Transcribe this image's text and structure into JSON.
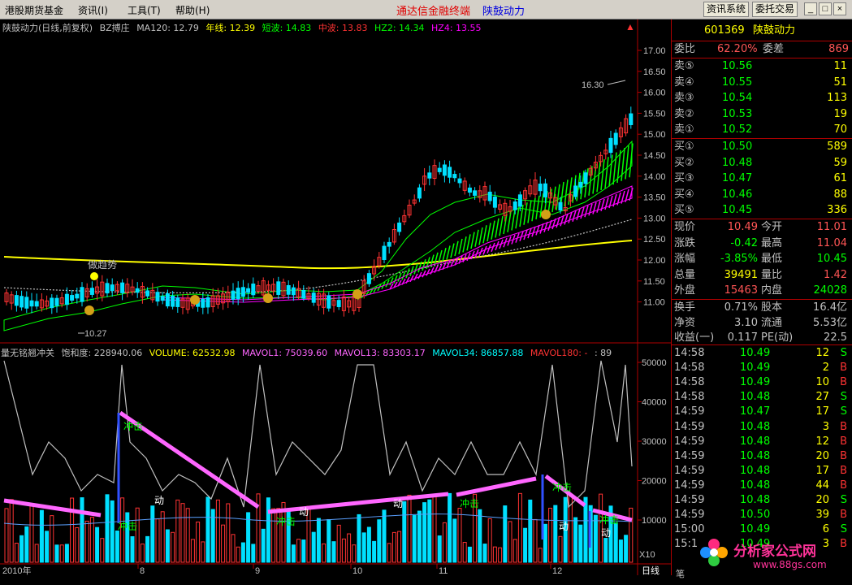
{
  "menu": {
    "items": [
      "港股期货基金",
      "资讯(I)",
      "工具(T)",
      "帮助(H)"
    ],
    "app_title": "通达信金融终端",
    "stock_title": "陕鼓动力",
    "right_buttons": [
      "资讯系统",
      "委托交易"
    ],
    "window_buttons": [
      "_",
      "□",
      "×"
    ]
  },
  "main_legend": {
    "name": "陕鼓动力(日线,前复权)",
    "indicator": "BZ搏庄",
    "ma120": "MA120: 12.79",
    "nianxian": "年线: 12.39",
    "duanbo": "短波: 14.83",
    "zhongbo": "中波: 13.83",
    "hz2": "HZ2: 14.34",
    "hz4": "HZ4: 13.55"
  },
  "price_axis": [
    "17.00",
    "16.50",
    "16.00",
    "15.50",
    "15.00",
    "14.50",
    "14.00",
    "13.50",
    "13.00",
    "12.50",
    "12.00",
    "11.50",
    "11.00"
  ],
  "annotations": {
    "high_label": "16.30",
    "low_label": "10.27",
    "trend_label": "做趋势"
  },
  "sub_legend": {
    "name": "量无铭翘冲关",
    "baohedu": "饱和度: 228940.06",
    "volume": "VOLUME: 62532.98",
    "mavol1": "MAVOL1: 75039.60",
    "mavol13": "MAVOL13: 83303.17",
    "mavol34": "MAVOL34: 86857.88",
    "mavol180": "MAVOL180: -",
    "tail": ": 89"
  },
  "vol_axis": [
    "50000",
    "40000",
    "30000",
    "20000",
    "10000"
  ],
  "vol_axis_unit": "X10",
  "vol_labels": [
    "冲击",
    "冲击",
    "冲击",
    "冲击",
    "冲击",
    "冲击",
    "动",
    "动",
    "动",
    "动",
    "动"
  ],
  "date_axis": [
    "2010年",
    "8",
    "9",
    "10",
    "11",
    "12"
  ],
  "date_axis_right": "日线",
  "quote": {
    "code": "601369",
    "name": "陕鼓动力",
    "weibi_label": "委比",
    "weibi": "62.20%",
    "weicha_label": "委差",
    "weicha": "869",
    "sells": [
      {
        "label": "卖⑤",
        "price": "10.56",
        "vol": "11"
      },
      {
        "label": "卖④",
        "price": "10.55",
        "vol": "51"
      },
      {
        "label": "卖③",
        "price": "10.54",
        "vol": "113"
      },
      {
        "label": "卖②",
        "price": "10.53",
        "vol": "19"
      },
      {
        "label": "卖①",
        "price": "10.52",
        "vol": "70"
      }
    ],
    "buys": [
      {
        "label": "买①",
        "price": "10.50",
        "vol": "589"
      },
      {
        "label": "买②",
        "price": "10.48",
        "vol": "59"
      },
      {
        "label": "买③",
        "price": "10.47",
        "vol": "61"
      },
      {
        "label": "买④",
        "price": "10.46",
        "vol": "88"
      },
      {
        "label": "买⑤",
        "price": "10.45",
        "vol": "336"
      }
    ],
    "stats": [
      {
        "l1": "现价",
        "v1": "10.49",
        "l2": "今开",
        "v2": "11.01",
        "c1": "#ff5555",
        "c2": "#ff5555"
      },
      {
        "l1": "涨跌",
        "v1": "-0.42",
        "l2": "最高",
        "v2": "11.04",
        "c1": "#00ff00",
        "c2": "#ff5555"
      },
      {
        "l1": "涨幅",
        "v1": "-3.85%",
        "l2": "最低",
        "v2": "10.45",
        "c1": "#00ff00",
        "c2": "#00ff00"
      },
      {
        "l1": "总量",
        "v1": "39491",
        "l2": "量比",
        "v2": "1.42",
        "c1": "#ffff00",
        "c2": "#ff5555"
      },
      {
        "l1": "外盘",
        "v1": "15463",
        "l2": "内盘",
        "v2": "24028",
        "c1": "#ff5555",
        "c2": "#00ff00"
      }
    ],
    "stats2": [
      {
        "l1": "换手",
        "v1": "0.71%",
        "l2": "股本",
        "v2": "16.4亿"
      },
      {
        "l1": "净资",
        "v1": "3.10",
        "l2": "流通",
        "v2": "5.53亿"
      },
      {
        "l1": "收益(一)",
        "v1": "0.117",
        "l2": "PE(动)",
        "v2": "22.5"
      }
    ],
    "ticks": [
      {
        "t": "14:58",
        "p": "10.49",
        "v": "12",
        "s": "S"
      },
      {
        "t": "14:58",
        "p": "10.49",
        "v": "2",
        "s": "B"
      },
      {
        "t": "14:58",
        "p": "10.49",
        "v": "10",
        "s": "B"
      },
      {
        "t": "14:58",
        "p": "10.48",
        "v": "27",
        "s": "S"
      },
      {
        "t": "14:59",
        "p": "10.47",
        "v": "17",
        "s": "S"
      },
      {
        "t": "14:59",
        "p": "10.48",
        "v": "3",
        "s": "B"
      },
      {
        "t": "14:59",
        "p": "10.48",
        "v": "12",
        "s": "B"
      },
      {
        "t": "14:59",
        "p": "10.48",
        "v": "20",
        "s": "B"
      },
      {
        "t": "14:59",
        "p": "10.48",
        "v": "17",
        "s": "B"
      },
      {
        "t": "14:59",
        "p": "10.48",
        "v": "44",
        "s": "B"
      },
      {
        "t": "14:59",
        "p": "10.48",
        "v": "20",
        "s": "S"
      },
      {
        "t": "14:59",
        "p": "10.50",
        "v": "39",
        "s": "B"
      },
      {
        "t": "15:00",
        "p": "10.49",
        "v": "6",
        "s": "S"
      },
      {
        "t": "15:1",
        "p": "10.49",
        "v": "3",
        "s": "B"
      }
    ]
  },
  "status": {
    "right_label": "笔"
  },
  "watermark": {
    "text": "分析家公式网",
    "url": "www.88gs.com"
  },
  "colors": {
    "up": "#ff3333",
    "down": "#00e0ff",
    "ma_yellow": "#ffff00",
    "ribbon_green": "#00ff00",
    "ribbon_magenta": "#ff00ff"
  }
}
